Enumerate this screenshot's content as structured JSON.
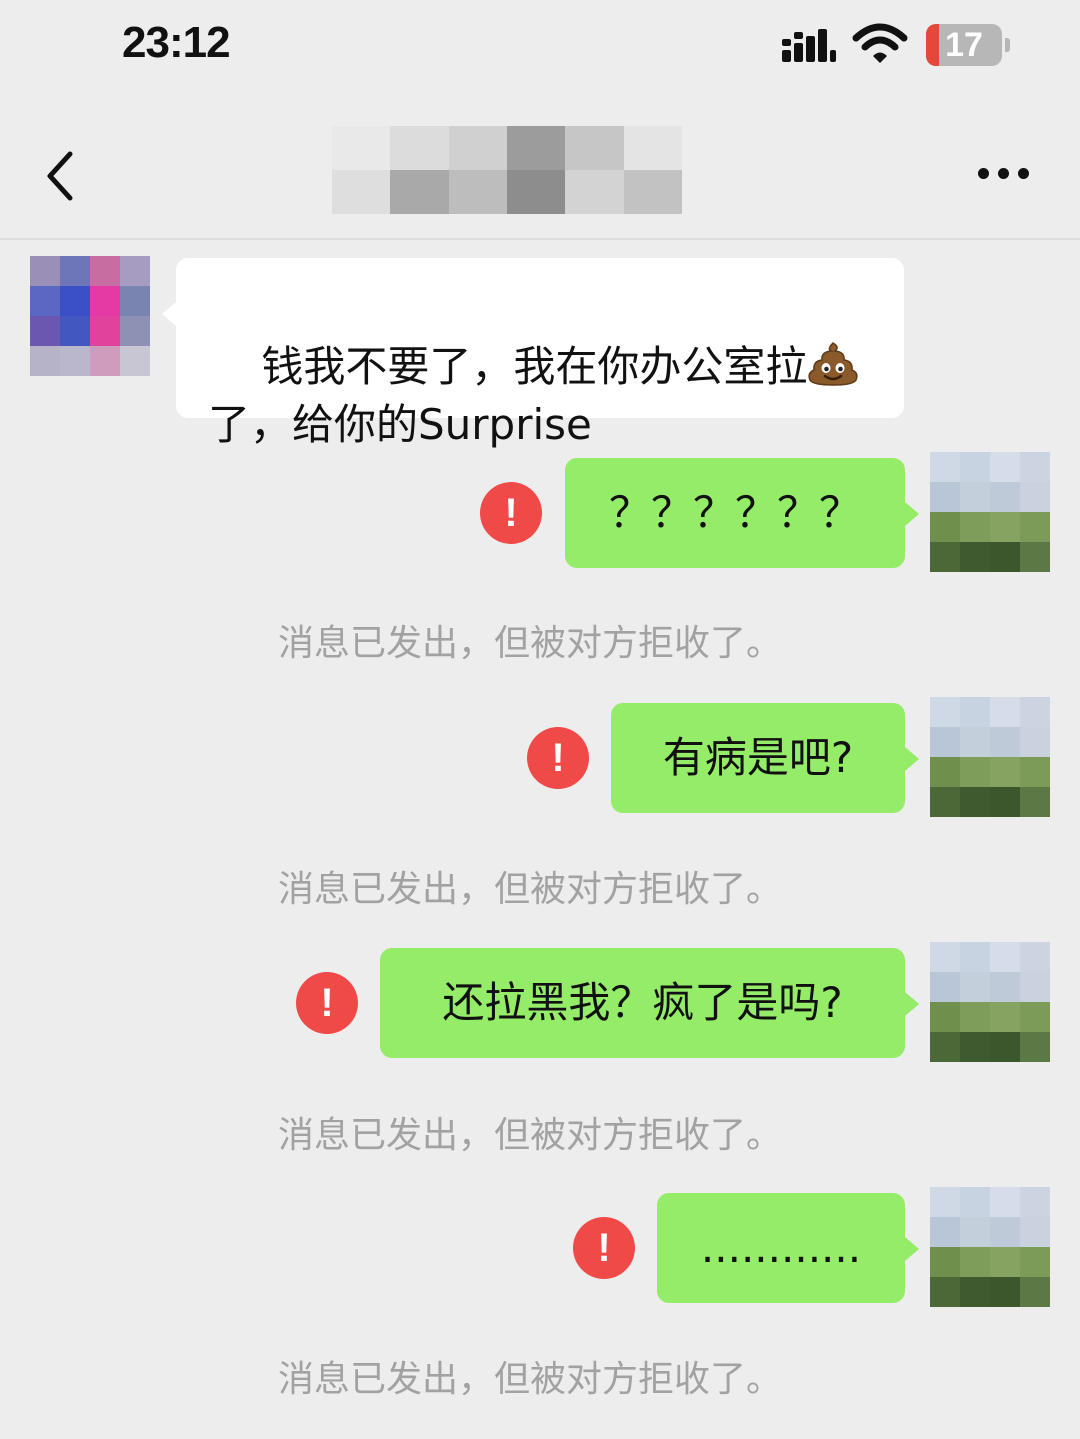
{
  "status_bar": {
    "time": "23:12",
    "battery_level": "17",
    "battery_fraction": 0.17,
    "signal_icon": "cellular-signal-icon",
    "wifi_icon": "wifi-icon",
    "battery_icon": "battery-low-icon",
    "battery_color": "#e5473b"
  },
  "nav": {
    "back_icon": "chevron-left-icon",
    "more_icon": "more-dots-icon",
    "title_pixelated": true
  },
  "theme": {
    "background": "#ededed",
    "incoming_bubble": "#ffffff",
    "outgoing_bubble": "#95ec69",
    "error_badge": "#f04a48",
    "notice_text": "#a2a2a2"
  },
  "messages": {
    "incoming": {
      "line1": "钱我不要了，我在你办公室拉",
      "emoji": "pile-of-poo-icon",
      "line2": "了，给你的Surprise"
    },
    "outgoing": [
      {
        "text": "？？？？？？",
        "status_icon": "exclamation-error-icon",
        "status_mark": "!"
      },
      {
        "text": "有病是吧?",
        "status_icon": "exclamation-error-icon",
        "status_mark": "!"
      },
      {
        "text": "还拉黑我？疯了是吗?",
        "status_icon": "exclamation-error-icon",
        "status_mark": "!"
      },
      {
        "text": "............",
        "status_icon": "exclamation-error-icon",
        "status_mark": "!"
      }
    ],
    "rejected_notice": "消息已发出，但被对方拒收了。"
  }
}
